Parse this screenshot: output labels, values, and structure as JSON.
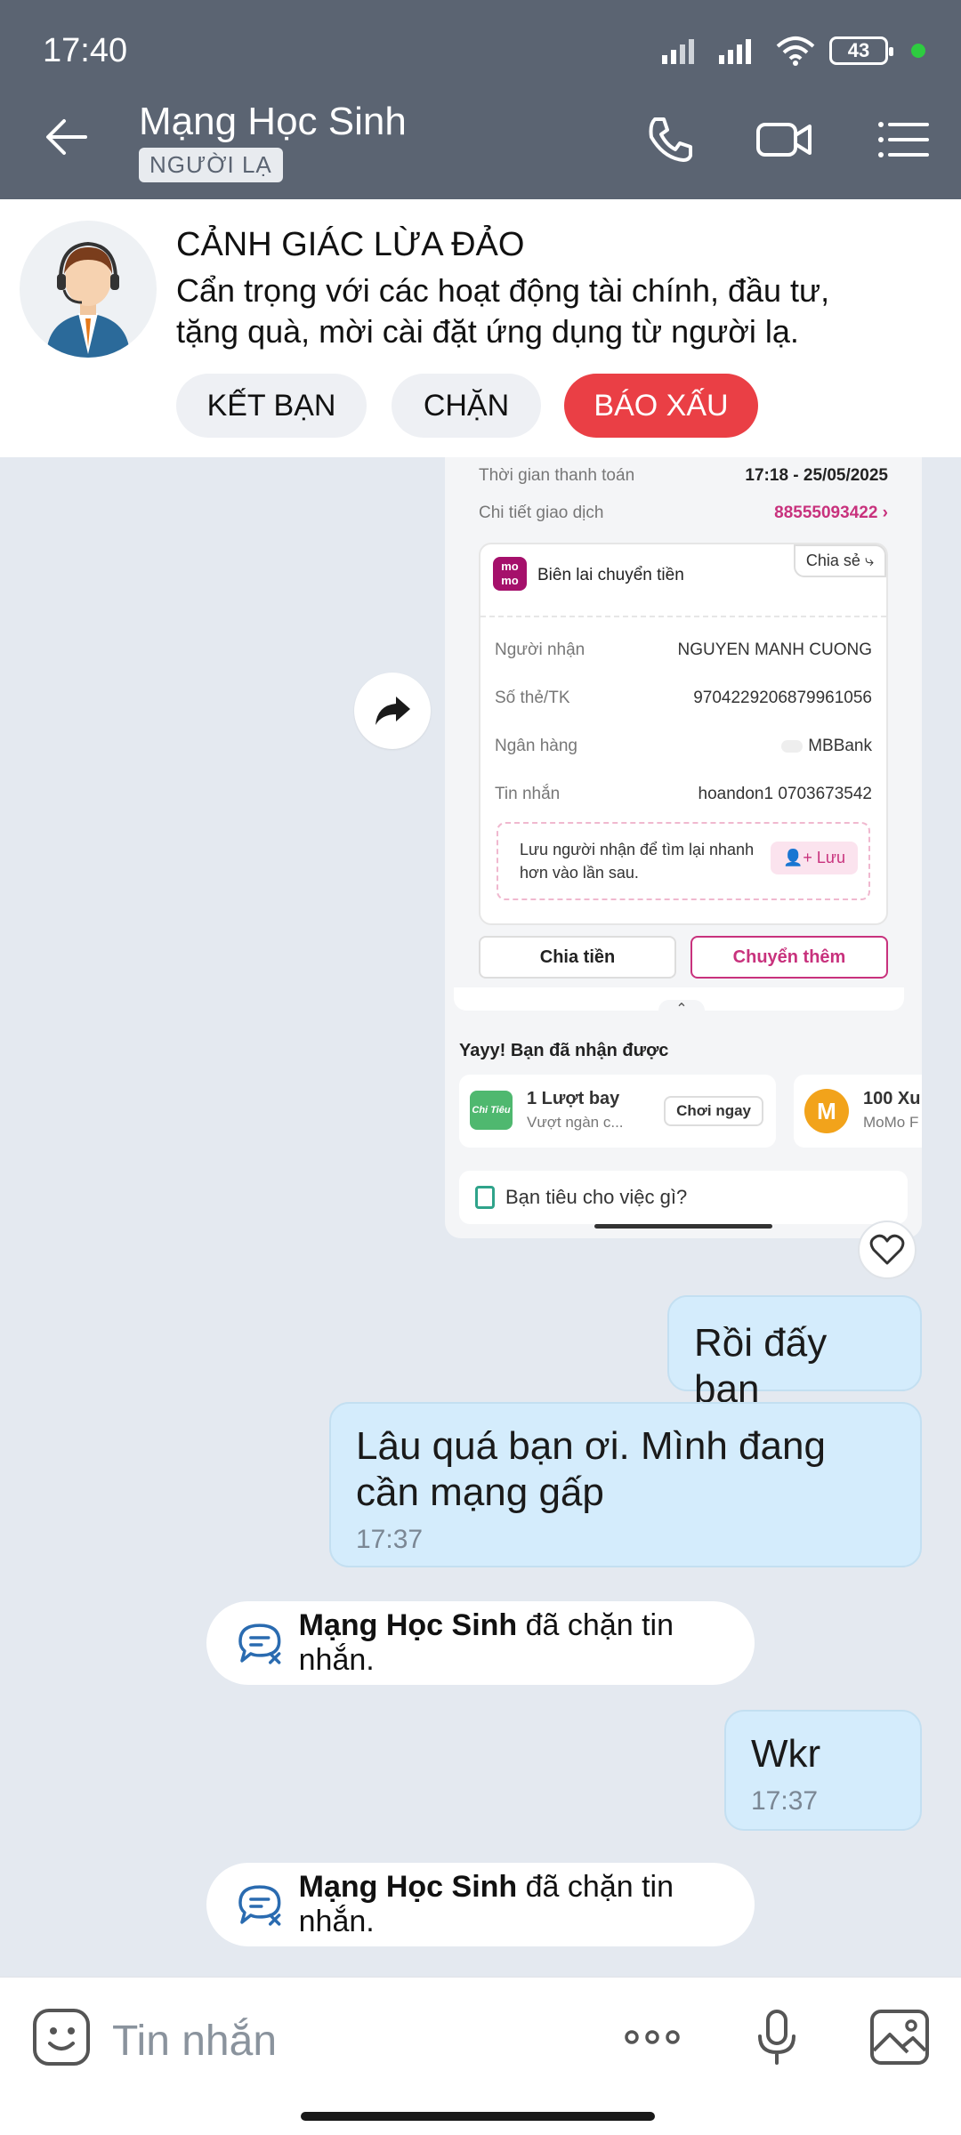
{
  "status": {
    "time": "17:40",
    "battery": "43"
  },
  "header": {
    "title": "Mạng Học Sinh",
    "tag": "NGƯỜI LẠ"
  },
  "warning": {
    "title": "CẢNH GIÁC LỪA ĐẢO",
    "line1": "Cẩn trọng với các hoạt động tài chính, đầu tư,",
    "line2": "tặng quà, mời cài đặt ứng dụng từ người lạ.",
    "buttons": {
      "add_friend": "KẾT BẠN",
      "block": "CHẶN",
      "report": "BÁO XẤU"
    }
  },
  "receipt": {
    "pay_time_label": "Thời gian thanh toán",
    "pay_time_value": "17:18 - 25/05/2025",
    "detail_label": "Chi tiết giao dịch",
    "detail_value": "88555093422 ›",
    "logo_text": "mo mo",
    "card_title": "Biên lai chuyển tiền",
    "share": "Chia sẻ",
    "recipient_label": "Người nhận",
    "recipient_value": "NGUYEN MANH CUONG",
    "account_label": "Số thẻ/TK",
    "account_value": "9704229206879961056",
    "bank_label": "Ngân hàng",
    "bank_value": "MBBank",
    "message_label": "Tin nhắn",
    "message_value": "hoandon1 0703673542",
    "save_hint_1": "Lưu người nhận để tìm lại nhanh",
    "save_hint_2": "hơn vào lần sau.",
    "save_btn": "Lưu",
    "split_btn": "Chia tiền",
    "transfer_more_btn": "Chuyển thêm",
    "reward_header": "Yayy! Bạn đã nhận được",
    "reward1_title": "1 Lượt bay",
    "reward1_sub": "Vượt ngàn c...",
    "reward1_btn": "Chơi ngay",
    "reward1_badge": "Chi Tiêu",
    "reward2_title": "100 Xu",
    "reward2_sub": "MoMo F",
    "spend_question": "Bạn tiêu cho việc gì?"
  },
  "messages": [
    {
      "text": "Rồi đấy bạn"
    },
    {
      "text": "Lâu quá bạn ơi. Mình đang cần mạng gấp",
      "time": "17:37"
    },
    {
      "text": "Wkr",
      "time": "17:37"
    }
  ],
  "system": {
    "name": "Mạng Học Sinh",
    "action": "đã chặn tin nhắn."
  },
  "input": {
    "placeholder": "Tin nhắn"
  },
  "colors": {
    "header": "#5b6472",
    "bubble": "#d4ecfc",
    "report": "#ea3f45",
    "momo": "#a5106b",
    "chat_bg": "#e4e9f0"
  }
}
